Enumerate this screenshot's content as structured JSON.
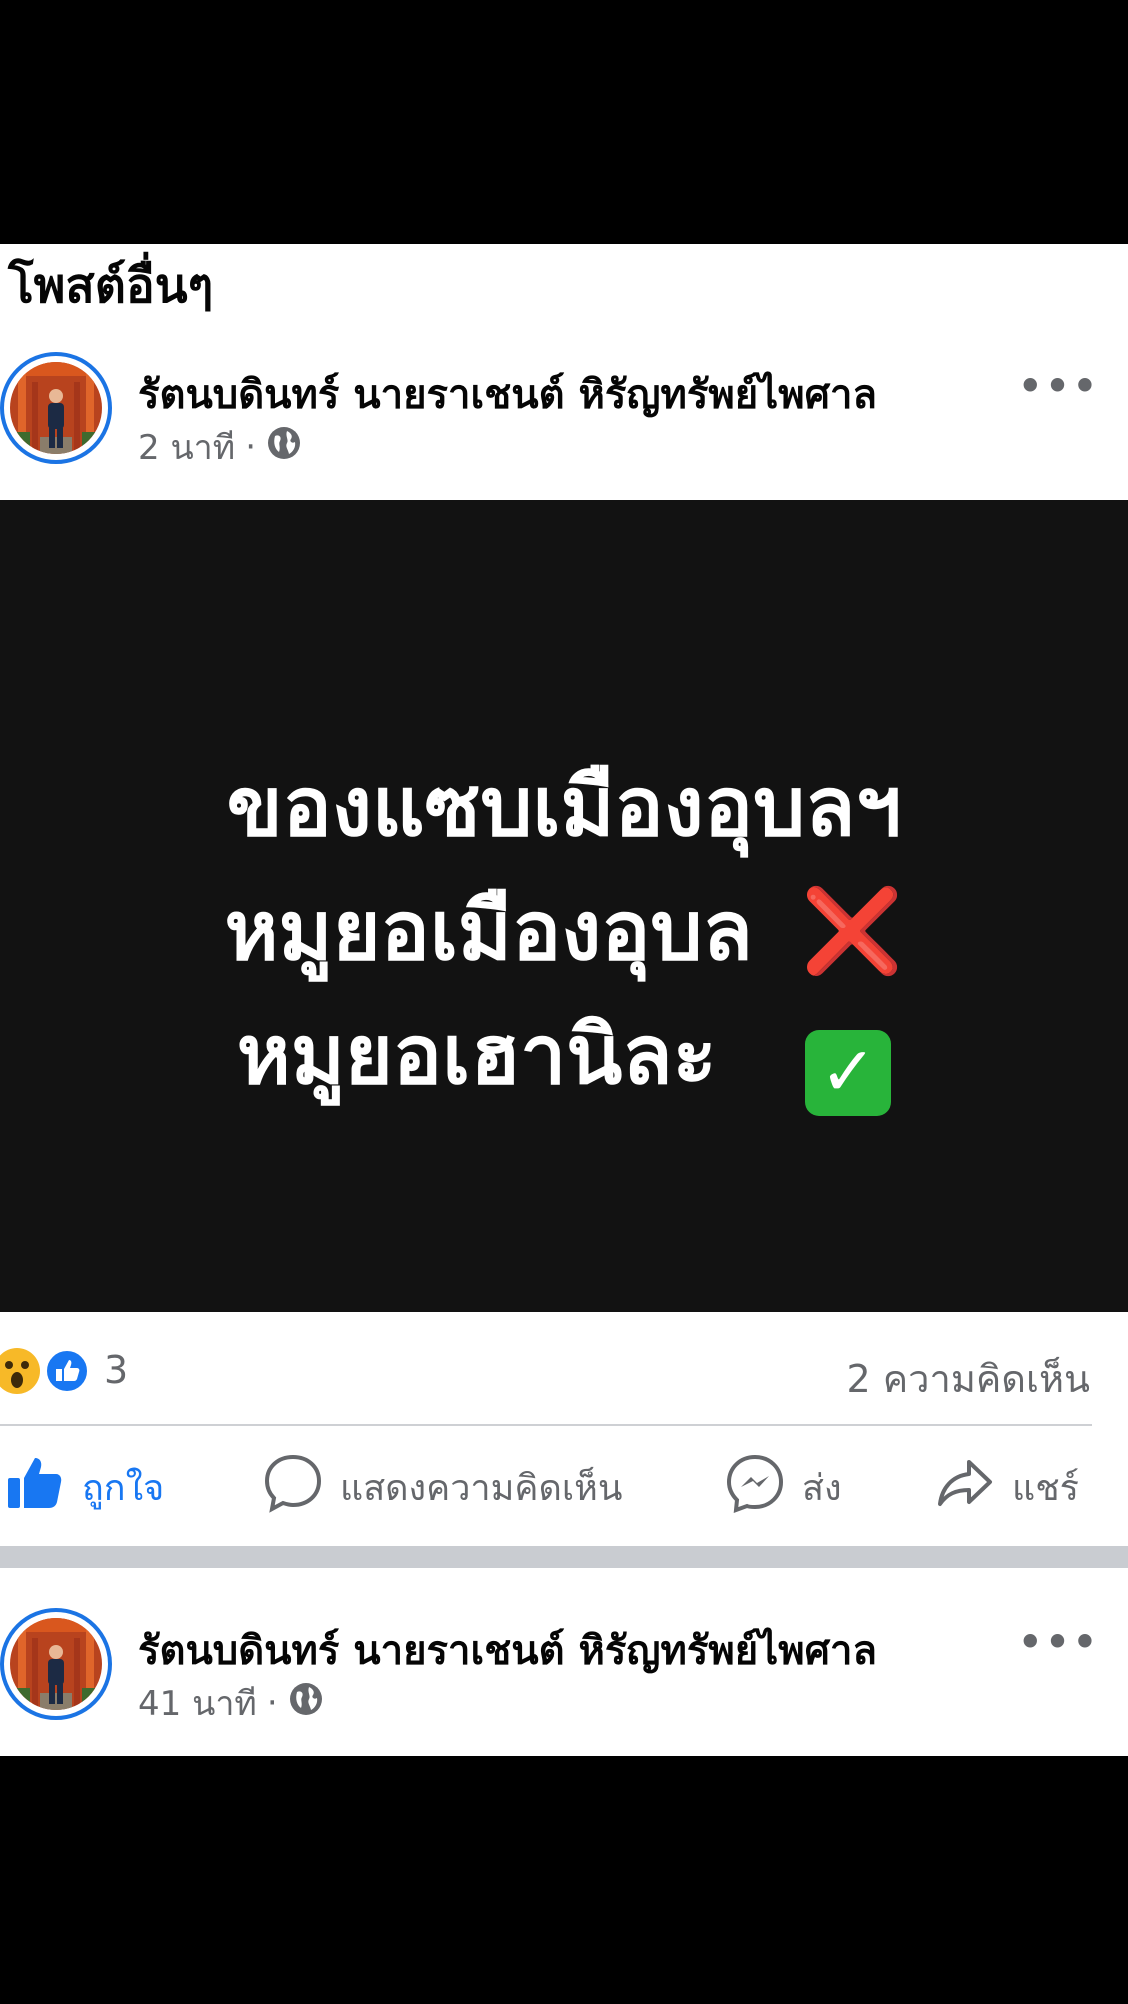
{
  "section": {
    "title": "โพสต์อื่นๆ"
  },
  "post1": {
    "author": "รัตนบดินทร์ นายราเชนต์ หิรัญทรัพย์ไพศาล",
    "time": "2 นาที",
    "separator": "·",
    "audience_icon": "globe-icon",
    "image_lines": [
      "ของแซบเมืองอุบลฯ",
      "หมูยอเมืองอุบล",
      "หมูยอเฮานิละ"
    ],
    "line2_emoji": "❌",
    "line3_emoji": "✅",
    "reaction_icons": [
      "wow-reaction-icon",
      "like-reaction-icon"
    ],
    "reaction_count": "3",
    "comment_count": "2 ความคิดเห็น",
    "actions": {
      "like": "ถูกใจ",
      "comment": "แสดงความคิดเห็น",
      "send": "ส่ง",
      "share": "แชร์"
    }
  },
  "post2": {
    "author": "รัตนบดินทร์ นายราเชนต์ หิรัญทรัพย์ไพศาล",
    "time": "41 นาที",
    "separator": "·",
    "audience_icon": "globe-icon"
  },
  "colors": {
    "accent": "#1877f2",
    "muted": "#65676b",
    "image_bg": "#121212"
  }
}
